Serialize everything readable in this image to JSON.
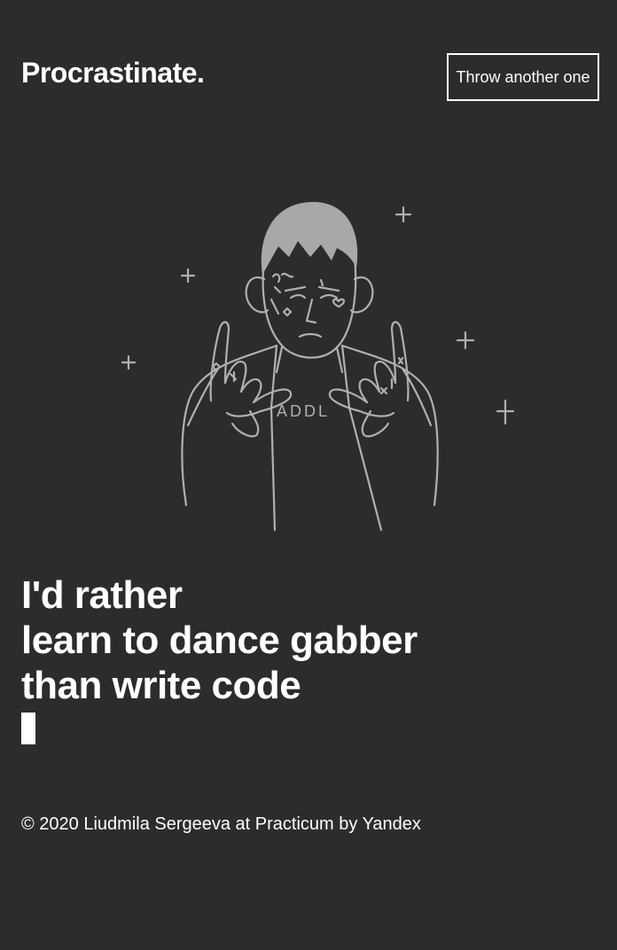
{
  "header": {
    "logo": "Procrastinate.",
    "throw_button_label": "Throw another one"
  },
  "illustration": {
    "subject": "person-with-devil-horn-hands-icon",
    "shirt_text": "ADDL",
    "line_color": "#b0b0b0",
    "hair_color": "#a8a8a8"
  },
  "phrase": {
    "line1": "I'd rather",
    "line2": "learn to dance gabber",
    "line3": "than write code"
  },
  "footer": {
    "copyright": "© 2020 Liudmila Sergeeva at Practicum by Yandex"
  },
  "colors": {
    "background": "#2c2c2c",
    "text": "#ffffff"
  }
}
